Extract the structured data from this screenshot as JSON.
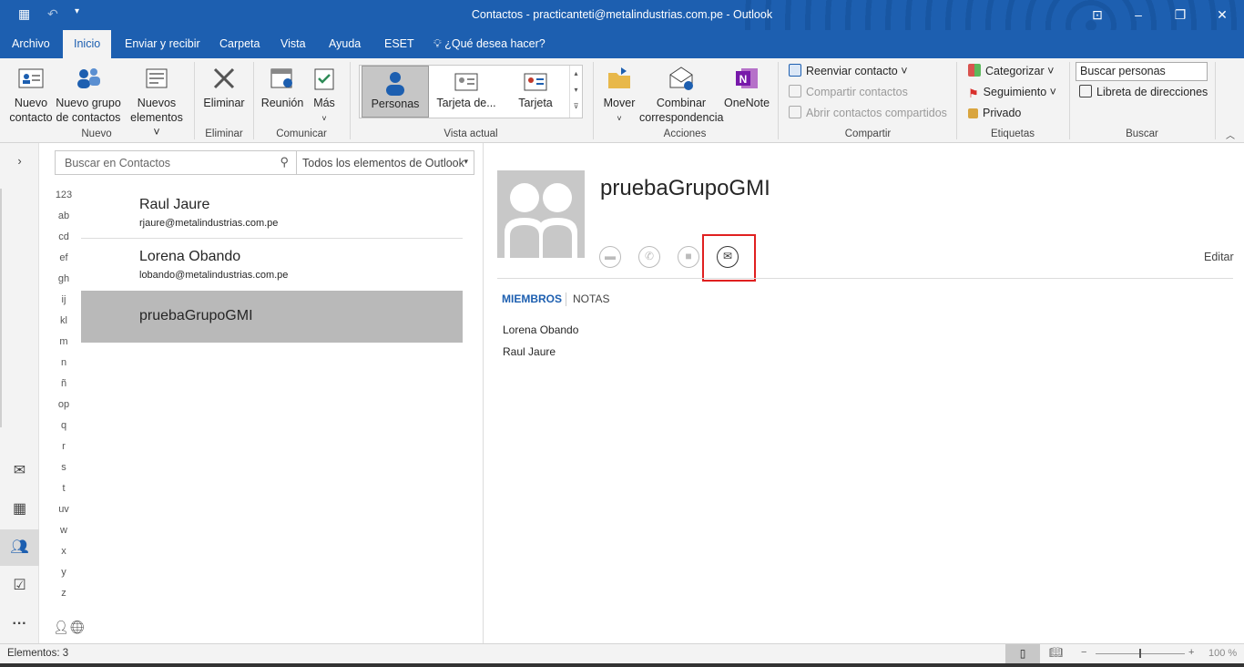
{
  "window": {
    "title": "Contactos - practicanteti@metalindustrias.com.pe  -  Outlook"
  },
  "menu": {
    "tabs": [
      "Archivo",
      "Inicio",
      "Enviar y recibir",
      "Carpeta",
      "Vista",
      "Ayuda",
      "ESET"
    ],
    "tellme": "¿Qué desea hacer?"
  },
  "ribbon": {
    "nuevo": {
      "contacto": [
        "Nuevo",
        "contacto"
      ],
      "grupo": [
        "Nuevo grupo",
        "de contactos"
      ],
      "elementos": [
        "Nuevos",
        "elementos ˅"
      ],
      "label": "Nuevo"
    },
    "eliminar": {
      "btn": "Eliminar",
      "label": "Eliminar"
    },
    "comunicar": {
      "reunion": "Reunión",
      "mas": "Más",
      "label": "Comunicar"
    },
    "vista": {
      "items": [
        "Personas",
        "Tarjeta de...",
        "Tarjeta"
      ],
      "label": "Vista actual"
    },
    "acciones": {
      "mover": "Mover",
      "combinar": [
        "Combinar",
        "correspondencia"
      ],
      "onenote": "OneNote",
      "label": "Acciones"
    },
    "compartir": {
      "reenviar": "Reenviar contacto ˅",
      "compartir": "Compartir contactos",
      "abrir": "Abrir contactos compartidos",
      "label": "Compartir"
    },
    "etiquetas": {
      "categorizar": "Categorizar ˅",
      "seguimiento": "Seguimiento ˅",
      "privado": "Privado",
      "label": "Etiquetas"
    },
    "buscar": {
      "placeholder": "Buscar personas",
      "libreta": "Libreta de direcciones",
      "label": "Buscar"
    }
  },
  "search": {
    "placeholder": "Buscar en Contactos",
    "scope": "Todos los elementos de Outlook"
  },
  "alphabet": [
    "123",
    "ab",
    "cd",
    "ef",
    "gh",
    "ij",
    "kl",
    "m",
    "n",
    "ñ",
    "op",
    "q",
    "r",
    "s",
    "t",
    "uv",
    "w",
    "x",
    "y",
    "z"
  ],
  "contacts": [
    {
      "name": "Raul Jaure",
      "email": "rjaure@metalindustrias.com.pe"
    },
    {
      "name": "Lorena Obando",
      "email": "lobando@metalindustrias.com.pe"
    },
    {
      "name": "pruebaGrupoGMI",
      "email": ""
    }
  ],
  "detail": {
    "name": "pruebaGrupoGMI",
    "edit": "Editar",
    "tabs": [
      "MIEMBROS",
      "NOTAS"
    ],
    "members": [
      "Lorena Obando",
      "Raul Jaure"
    ]
  },
  "status": {
    "items": "Elementos: 3",
    "zoom": "100 %"
  },
  "colors": {
    "accent": "#1d5fb0",
    "highlight": "#e02020"
  }
}
